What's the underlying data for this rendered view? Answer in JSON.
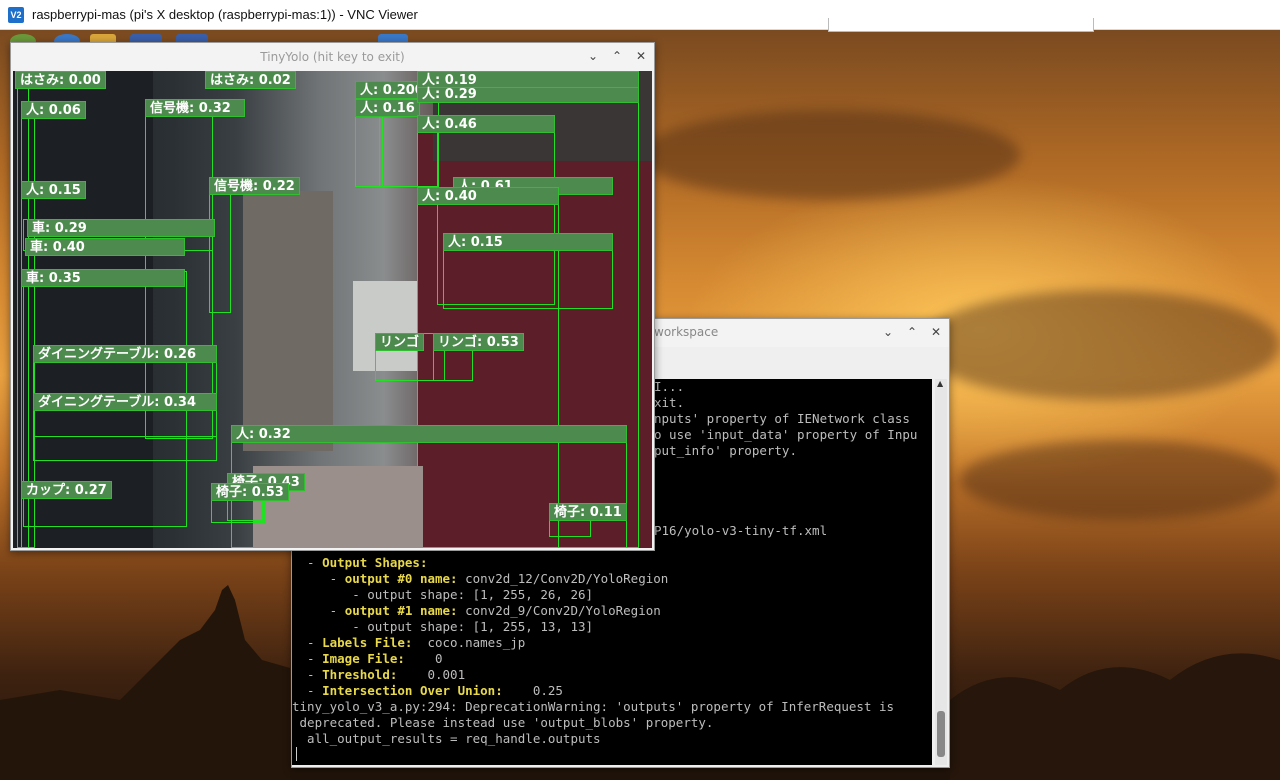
{
  "vnc": {
    "title": "raspberrypi-mas (pi's X desktop (raspberrypi-mas:1)) - VNC Viewer",
    "logo_text": "V2"
  },
  "yolo_window": {
    "title": "TinyYolo (hit key to exit)",
    "detections": [
      {
        "label": "はさみ: 0.00"
      },
      {
        "label": "はさみ: 0.02"
      },
      {
        "label": "人: 0.06"
      },
      {
        "label": "信号機: 0.32"
      },
      {
        "label": "人: 0.200"
      },
      {
        "label": "人: 0.16"
      },
      {
        "label": "人: 0.19"
      },
      {
        "label": "人: 0.29"
      },
      {
        "label": "人: 0.46"
      },
      {
        "label": "信号機: 0.22"
      },
      {
        "label": "人: 0.15"
      },
      {
        "label": "人: 0.61"
      },
      {
        "label": "人: 0.40"
      },
      {
        "label": "車: 0.29"
      },
      {
        "label": "車: 0.40"
      },
      {
        "label": "人: 0.15"
      },
      {
        "label": "車: 0.35"
      },
      {
        "label": "リンゴ"
      },
      {
        "label": "リンゴ: 0.53"
      },
      {
        "label": "ダイニングテーブル: 0.26"
      },
      {
        "label": "ダイニングテーブル: 0.34"
      },
      {
        "label": "人: 0.32"
      },
      {
        "label": "椅子: 0.43"
      },
      {
        "label": "カップ: 0.27"
      },
      {
        "label": "椅子: 0.53"
      },
      {
        "label": "椅子: 0.11"
      }
    ]
  },
  "terminal": {
    "title": "workspace",
    "lines": [
      {
        "text": "I..."
      },
      {
        "text": "xit."
      },
      {
        "text": "nputs' property of IENetwork class"
      },
      {
        "text": "o use 'input_data' property of Inpu"
      },
      {
        "text": "put_info' property."
      },
      {
        "text": "P16/yolo-v3-tiny-tf.xml"
      },
      {
        "text": "  - ",
        "key": "Output Shapes:",
        "rest": ""
      },
      {
        "text": "     - ",
        "key": "output #0 name:",
        "rest": " conv2d_12/Conv2D/YoloRegion"
      },
      {
        "text": "        - output shape: [1, 255, 26, 26]"
      },
      {
        "text": "     - ",
        "key": "output #1 name:",
        "rest": " conv2d_9/Conv2D/YoloRegion"
      },
      {
        "text": "        - output shape: [1, 255, 13, 13]"
      },
      {
        "text": "  - ",
        "key": "Labels File:",
        "rest": "  coco.names_jp"
      },
      {
        "text": "  - ",
        "key": "Image File:",
        "rest": "    0"
      },
      {
        "text": "  - ",
        "key": "Threshold:",
        "rest": "    0.001"
      },
      {
        "text": "  - ",
        "key": "Intersection Over Union:",
        "rest": "    0.25"
      },
      {
        "text": "tiny_yolo_v3_a.py:294: DeprecationWarning: 'outputs' property of InferRequest is"
      },
      {
        "text": " deprecated. Please instead use 'output_blobs' property."
      },
      {
        "text": "  all_output_results = req_handle.outputs"
      }
    ]
  },
  "colors": {
    "detection_box": "#22e022",
    "detection_label_bg": "#4d8a4d",
    "terminal_key": "#e8d84a"
  }
}
